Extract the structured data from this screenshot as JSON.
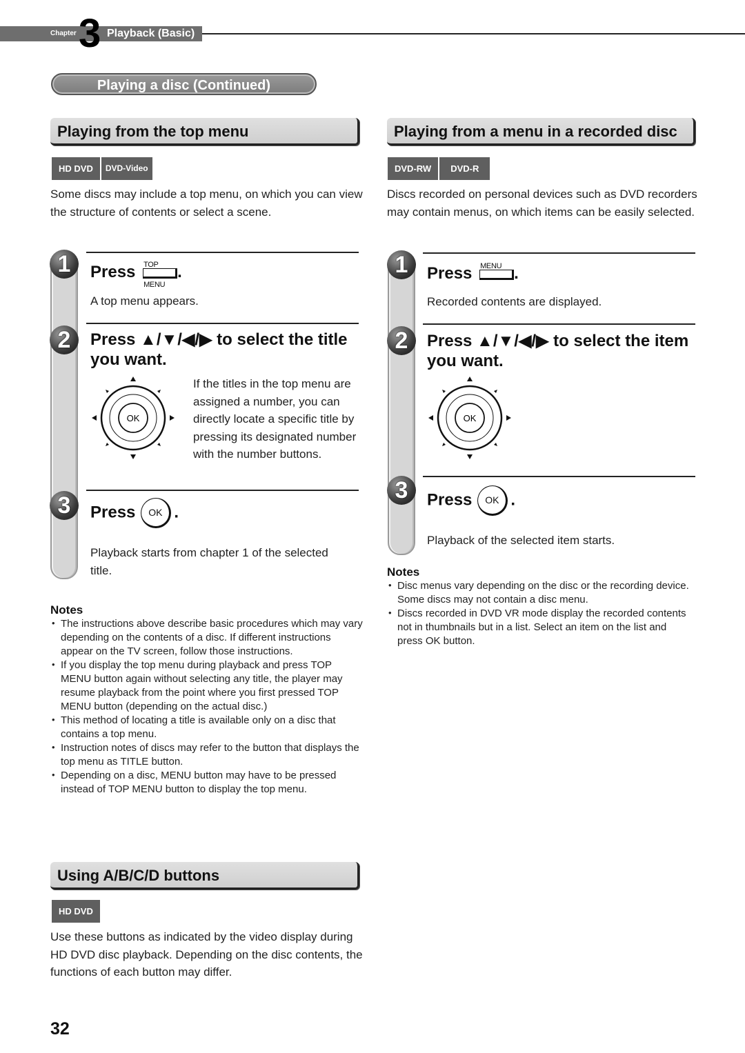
{
  "chapter": {
    "label": "Chapter",
    "number": "3",
    "title": "Playback (Basic)"
  },
  "section_pill": "Playing a disc (Continued)",
  "left": {
    "heading": "Playing from the top menu",
    "badges": [
      "HD DVD",
      "DVD-Video"
    ],
    "intro": "Some discs may include a top menu, on which you can view the structure of contents or select a scene.",
    "steps": [
      {
        "number": "1",
        "press": "Press",
        "button_label": "TOP MENU",
        "suffix": ".",
        "desc": "A top menu appears."
      },
      {
        "number": "2",
        "heading": "Press ▲/▼/◀/▶ to select the title you want.",
        "dpad_label": "OK",
        "desc": "If the titles in the top menu are assigned a number, you can directly locate a specific title by pressing its designated number with the number buttons."
      },
      {
        "number": "3",
        "press": "Press",
        "button_label": "OK",
        "suffix": ".",
        "desc": "Playback starts from chapter 1 of the selected title."
      }
    ],
    "notes_title": "Notes",
    "notes": [
      "The instructions above describe basic procedures which may vary depending on the contents of a disc. If different instructions appear on the TV screen, follow those instructions.",
      "If you display the top menu during playback and press TOP MENU button again without selecting any title, the player may resume playback from the point where you first pressed TOP MENU button (depending on the actual disc.)",
      "This method of locating a title is available only on a disc that contains a top menu.",
      "Instruction notes of discs may refer to the button that displays the top menu as TITLE button.",
      "Depending on a disc, MENU button may have to be pressed instead of TOP MENU button to display the top menu."
    ],
    "abcd": {
      "heading": "Using A/B/C/D buttons",
      "badges": [
        "HD DVD"
      ],
      "text": "Use these buttons as indicated by the video display during HD DVD disc playback. Depending on the disc contents, the functions of each button may differ."
    }
  },
  "right": {
    "heading": "Playing from a menu in a recorded disc",
    "badges": [
      "DVD-RW",
      "DVD-R"
    ],
    "intro": "Discs recorded on personal devices such as DVD recorders may contain menus, on which items can be easily selected.",
    "steps": [
      {
        "number": "1",
        "press": "Press",
        "button_label": "MENU",
        "suffix": ".",
        "desc": "Recorded contents are displayed."
      },
      {
        "number": "2",
        "heading": "Press ▲/▼/◀/▶ to select the item you want.",
        "dpad_label": "OK"
      },
      {
        "number": "3",
        "press": "Press",
        "button_label": "OK",
        "suffix": ".",
        "desc": "Playback of the selected item starts."
      }
    ],
    "notes_title": "Notes",
    "notes": [
      "Disc menus vary depending on the disc or the recording device. Some discs may not contain a disc menu.",
      "Discs recorded in DVD VR mode display the recorded contents not in thumbnails but in a list. Select an item on the list and press OK button."
    ]
  },
  "page_number": "32"
}
